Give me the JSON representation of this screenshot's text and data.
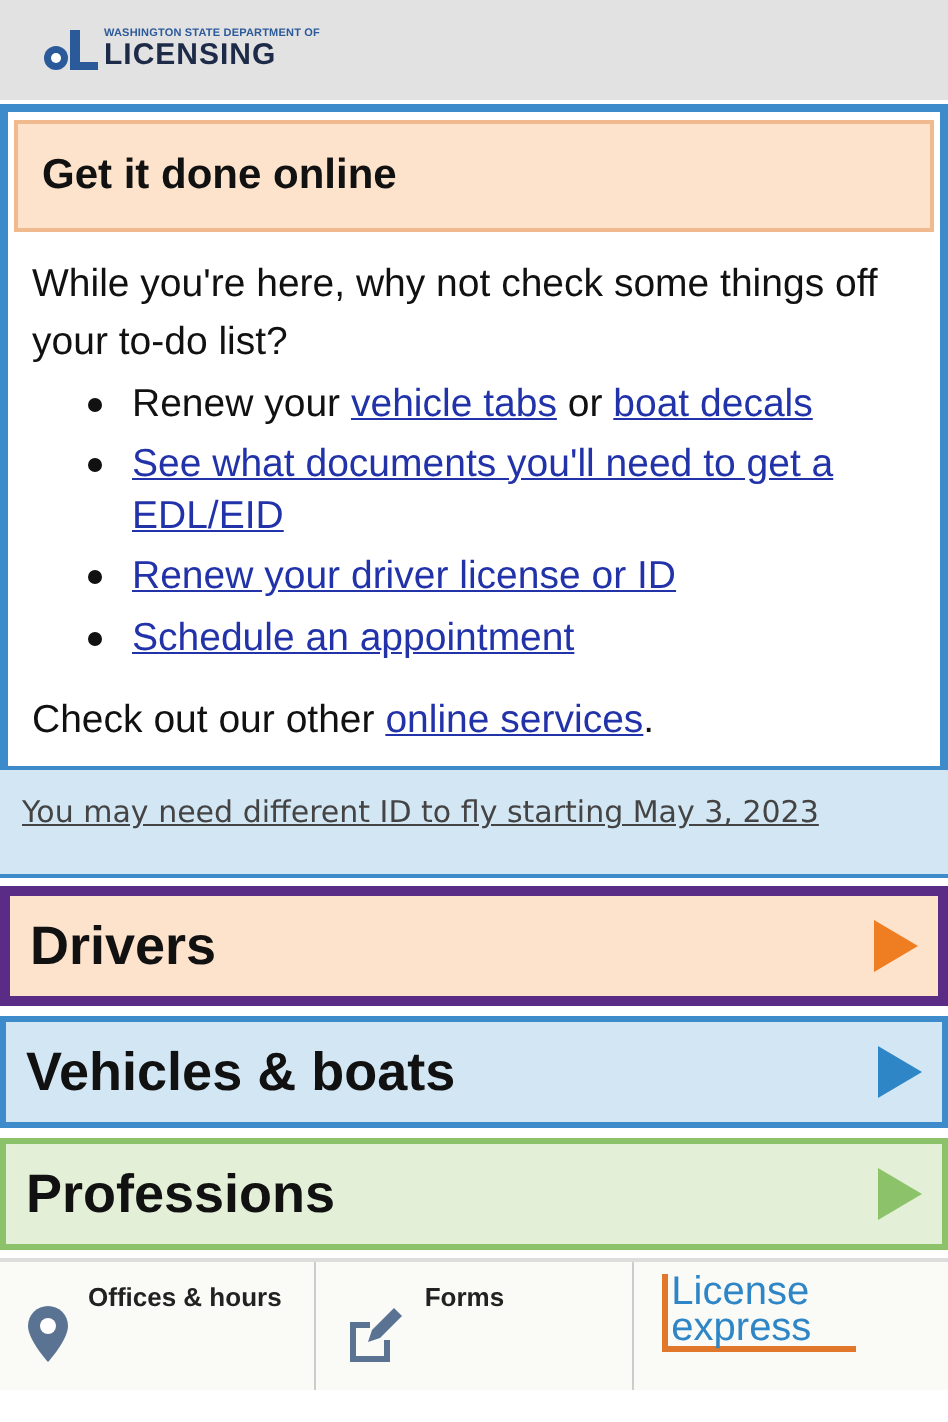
{
  "header": {
    "agency": "WASHINGTON STATE DEPARTMENT OF",
    "name": "LICENSING"
  },
  "online": {
    "title": "Get it done online",
    "intro": "While you're here, why not check some things off your to-do list?",
    "items": [
      [
        {
          "text": "Renew your ",
          "link": false
        },
        {
          "text": "vehicle tabs",
          "link": true
        },
        {
          "text": " or ",
          "link": false
        },
        {
          "text": "boat decals",
          "link": true
        }
      ],
      [
        {
          "text": "See what documents you'll need to get a EDL/EID",
          "link": true
        }
      ],
      [
        {
          "text": "Renew your driver license or ID",
          "link": true
        }
      ],
      [
        {
          "text": "Schedule an appointment",
          "link": true
        }
      ]
    ],
    "outro": [
      {
        "text": "Check out our other ",
        "link": false
      },
      {
        "text": "online services",
        "link": true
      },
      {
        "text": ".",
        "link": false
      }
    ]
  },
  "alert": "You may need different ID to fly starting May 3, 2023",
  "sections": [
    {
      "label": "Drivers",
      "color": "#ef7d22"
    },
    {
      "label": "Vehicles & boats",
      "color": "#2f86c6"
    },
    {
      "label": "Professions",
      "color": "#8cc36a"
    }
  ],
  "bottom": [
    {
      "kind": "pin",
      "label": "Offices & hours"
    },
    {
      "kind": "form",
      "label": "Forms"
    },
    {
      "kind": "brand",
      "label": "License",
      "sub": "express"
    }
  ]
}
